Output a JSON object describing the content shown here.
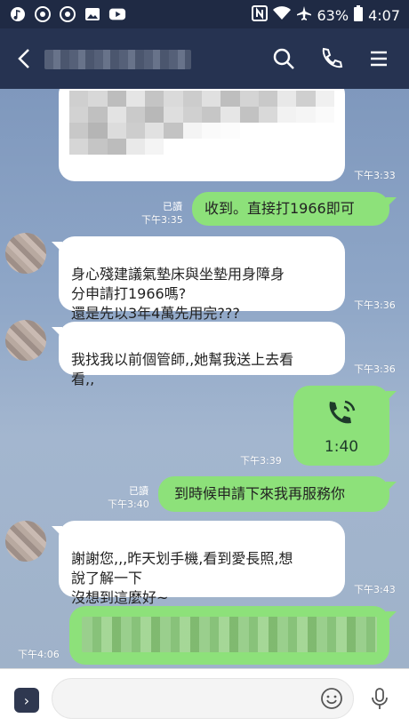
{
  "status_bar": {
    "battery": "63%",
    "time": "4:07"
  },
  "header": {
    "contact_name_blurred": ""
  },
  "messages": [
    {
      "time": "下午3:33"
    },
    {
      "text": "收到。直接打1966即可",
      "read": "已讀",
      "time": "下午3:35"
    },
    {
      "text": "身心殘建議氣墊床與坐墊用身障身\n分申請打1966嗎?\n還是先以3年4萬先用完???",
      "time": "下午3:36"
    },
    {
      "text": "我找我以前個管師,,她幫我送上去看\n看,,",
      "time": "下午3:36"
    },
    {
      "call_duration": "1:40",
      "time": "下午3:39"
    },
    {
      "text": "到時候申請下來我再服務你",
      "read": "已讀",
      "time": "下午3:40"
    },
    {
      "text": "謝謝您,,,昨天划手機,看到愛長照,想\n說了解一下\n沒想到這麼好~",
      "time": "下午3:43"
    },
    {
      "time": "下午4:06"
    }
  ],
  "colors": {
    "header_bg": "#263351",
    "my_bubble": "#8de17a",
    "their_bubble": "#ffffff"
  }
}
